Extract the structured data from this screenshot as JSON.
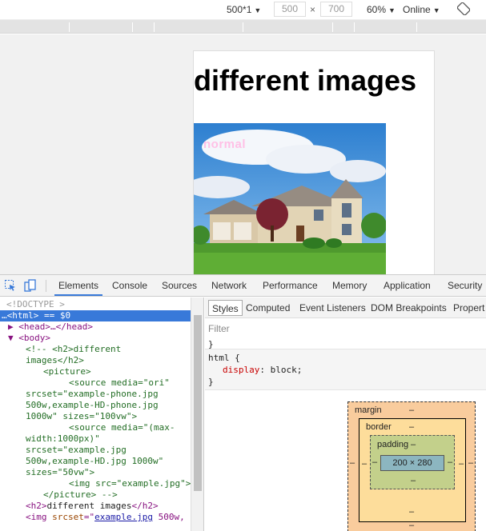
{
  "device_toolbar": {
    "dimensions_preset": "500*1",
    "width_value": "500",
    "times": "×",
    "height_value": "700",
    "zoom": "60%",
    "throttle": "Online",
    "caret": "▼"
  },
  "page": {
    "heading": "different images",
    "image_label": "normal"
  },
  "devtools": {
    "tabs": [
      "Elements",
      "Console",
      "Sources",
      "Network",
      "Performance",
      "Memory",
      "Application",
      "Security"
    ],
    "active_tab": "Elements",
    "elements_lines": [
      {
        "segments": [
          {
            "c": "gray",
            "t": "<!DOCTYPE >"
          }
        ]
      },
      {
        "segments": [
          {
            "c": "",
            "t": "…<html> == $0"
          }
        ]
      },
      {
        "segments": [
          {
            "c": "tag",
            "t": "▶ <head>…</head>"
          }
        ]
      },
      {
        "segments": [
          {
            "c": "tag",
            "t": "▼ <body>"
          }
        ]
      },
      {
        "segments": [
          {
            "c": "cmt",
            "t": "<!--   <h2>different"
          }
        ]
      },
      {
        "segments": [
          {
            "c": "cmt",
            "t": "images</h2>"
          }
        ]
      },
      {
        "segments": [
          {
            "c": "cmt",
            "t": "<picture>"
          }
        ]
      },
      {
        "segments": [
          {
            "c": "cmt",
            "t": "<source media=\"ori\""
          }
        ]
      },
      {
        "segments": [
          {
            "c": "cmt",
            "t": "srcset=\"example-phone.jpg"
          }
        ]
      },
      {
        "segments": [
          {
            "c": "cmt",
            "t": "500w,example-HD-phone.jpg"
          }
        ]
      },
      {
        "segments": [
          {
            "c": "cmt",
            "t": "1000w\" sizes=\"100vw\">"
          }
        ]
      },
      {
        "segments": [
          {
            "c": "cmt",
            "t": "<source media=\"(max-"
          }
        ]
      },
      {
        "segments": [
          {
            "c": "cmt",
            "t": "width:1000px)\""
          }
        ]
      },
      {
        "segments": [
          {
            "c": "cmt",
            "t": "srcset=\"example.jpg"
          }
        ]
      },
      {
        "segments": [
          {
            "c": "cmt",
            "t": "500w,example-HD.jpg 1000w\""
          }
        ]
      },
      {
        "segments": [
          {
            "c": "cmt",
            "t": "sizes=\"50vw\">"
          }
        ]
      },
      {
        "segments": [
          {
            "c": "cmt",
            "t": "<img src=\"example.jpg\">"
          }
        ]
      },
      {
        "segments": [
          {
            "c": "cmt",
            "t": "</picture> -->"
          }
        ]
      },
      {
        "segments": [
          {
            "c": "tag",
            "t": "<h2>"
          },
          {
            "c": "txt",
            "t": "different images"
          },
          {
            "c": "tag",
            "t": "</h2>"
          }
        ]
      },
      {
        "segments": [
          {
            "c": "tag",
            "t": "<img "
          },
          {
            "c": "attr",
            "t": "srcset"
          },
          {
            "c": "tag",
            "t": "=\""
          },
          {
            "c": "val",
            "t": "example.jpg"
          },
          {
            "c": "tag",
            "t": " 500w,"
          }
        ]
      }
    ],
    "styles_subtabs": [
      "Styles",
      "Computed",
      "Event Listeners",
      "DOM Breakpoints",
      "Propert"
    ],
    "filter_placeholder": "Filter",
    "css": {
      "closing_brace": "}",
      "selector": "html {",
      "property": "display",
      "value": "block;",
      "close": "}"
    },
    "box_model": {
      "margin_label": "margin",
      "border_label": "border",
      "padding_label": "padding",
      "dash": "–",
      "content_size": "200 × 280"
    }
  }
}
